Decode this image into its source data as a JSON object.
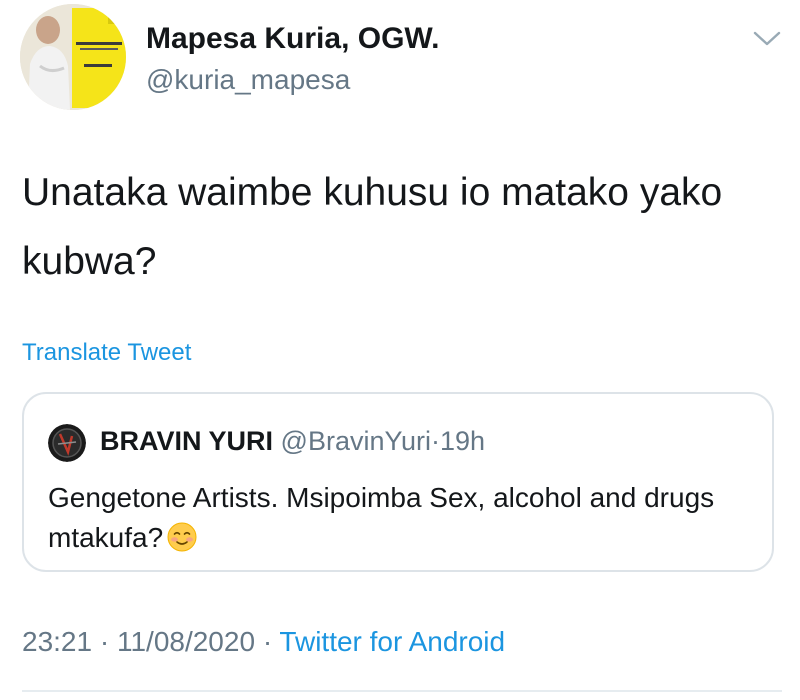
{
  "author": {
    "name": "Mapesa Kuria, OGW.",
    "handle": "@kuria_mapesa",
    "avatar_book_lines": [
      "KURIA MAPESA"
    ]
  },
  "caret_icon": "chevron-down-icon",
  "tweet": {
    "text": "Unataka waimbe kuhusu io matako yako kubwa?",
    "translate_label": "Translate Tweet"
  },
  "quoted": {
    "name": "BRAVIN YURI",
    "handle": "@BravinYuri",
    "separator": "·",
    "time": "19h",
    "text": "Gengetone Artists. Msipoimba Sex, alcohol and drugs mtakufa?",
    "emoji": "smiling-face-emoji"
  },
  "meta": {
    "time": "23:21",
    "separator": "·",
    "date": "11/08/2020",
    "separator2": "·",
    "source": "Twitter for Android"
  },
  "colors": {
    "link": "#1b95e0",
    "secondary": "#657786",
    "border": "#dde3e8",
    "text": "#14171a",
    "book_yellow": "#f5e419"
  }
}
